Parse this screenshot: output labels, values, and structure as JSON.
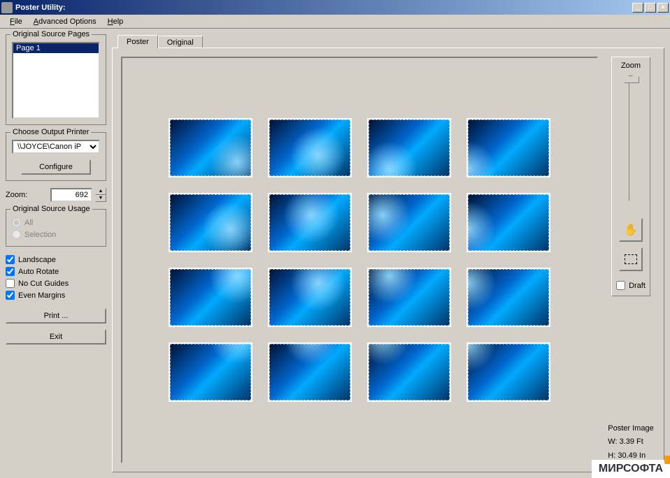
{
  "window": {
    "title": "Poster Utility:"
  },
  "menu": {
    "file": "File",
    "advanced": "Advanced Options",
    "help": "Help"
  },
  "sidebar": {
    "source_pages": {
      "title": "Original Source Pages",
      "item": "Page 1"
    },
    "printer": {
      "title": "Choose Output Printer",
      "value": "\\\\JOYCE\\Canon iP",
      "configure": "Configure"
    },
    "zoom": {
      "label": "Zoom:",
      "value": "692"
    },
    "usage": {
      "title": "Original Source Usage",
      "all": "All",
      "selection": "Selection"
    },
    "checks": {
      "landscape": "Landscape",
      "autorotate": "Auto Rotate",
      "nocut": "No Cut Guides",
      "even": "Even Margins"
    },
    "print": "Print ...",
    "exit": "Exit"
  },
  "tabs": {
    "poster": "Poster",
    "original": "Original"
  },
  "right": {
    "zoom": "Zoom",
    "draft": "Draft",
    "info_title": "Poster Image",
    "width": "W: 3.39 Ft",
    "height": "H: 30.49 In"
  },
  "watermark": "МИРСОФТА"
}
